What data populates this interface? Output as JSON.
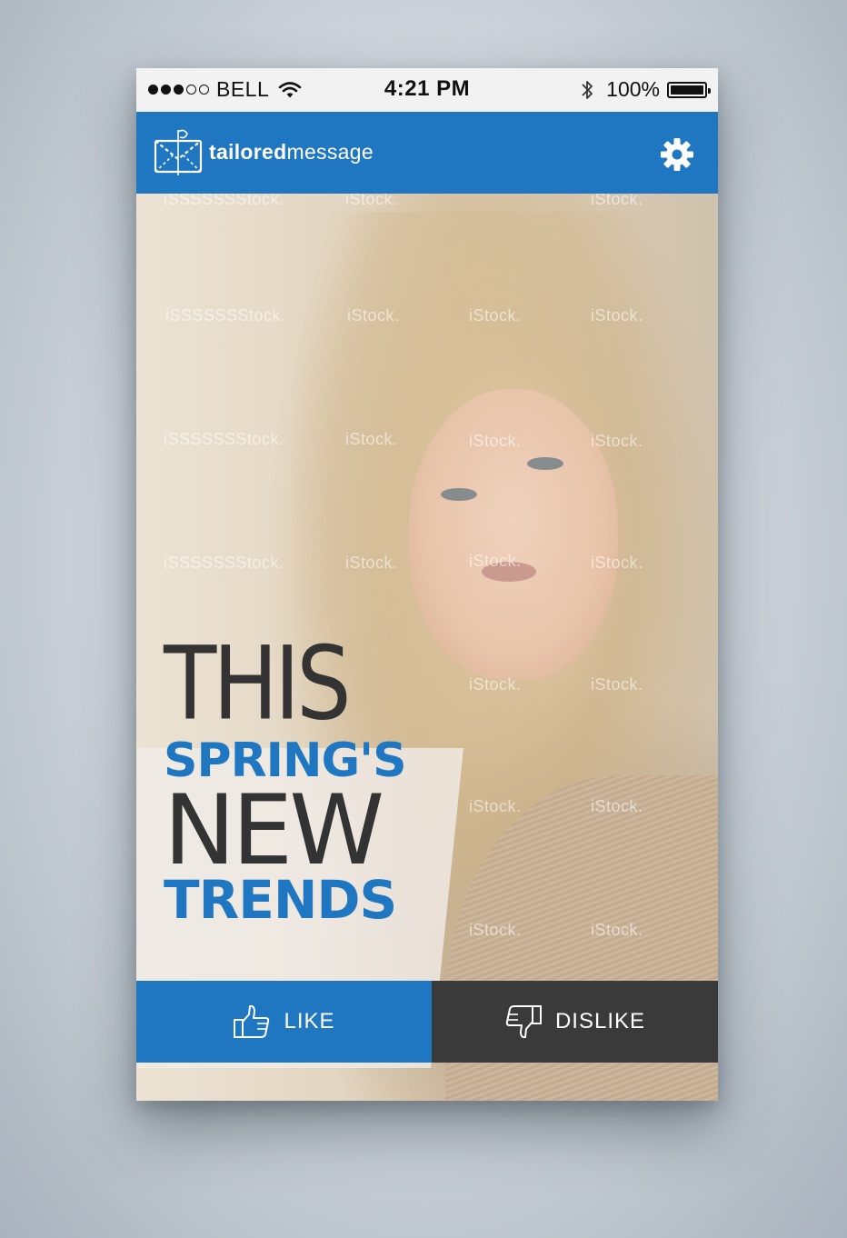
{
  "status_bar": {
    "signal_filled": 3,
    "signal_total": 5,
    "carrier": "BELL",
    "time": "4:21 PM",
    "battery_label": "100%",
    "battery_level": 1.0
  },
  "header": {
    "brand_bold": "tailored",
    "brand_regular": "message",
    "accent_color": "#1f77c2"
  },
  "hero": {
    "watermark_text": "iStock.",
    "watermark_text_alt": "iSSSSSSStock.",
    "headline": {
      "line1": "THIS",
      "line2": "SPRING'S",
      "line3": "NEW",
      "line4": "TRENDS"
    }
  },
  "actions": {
    "like_label": "LIKE",
    "dislike_label": "DISLIKE"
  },
  "icons": [
    "signal-dots",
    "wifi-icon",
    "bluetooth-icon",
    "battery-icon",
    "envelope-logo-icon",
    "gear-icon",
    "thumbs-up-icon",
    "thumbs-down-icon"
  ]
}
